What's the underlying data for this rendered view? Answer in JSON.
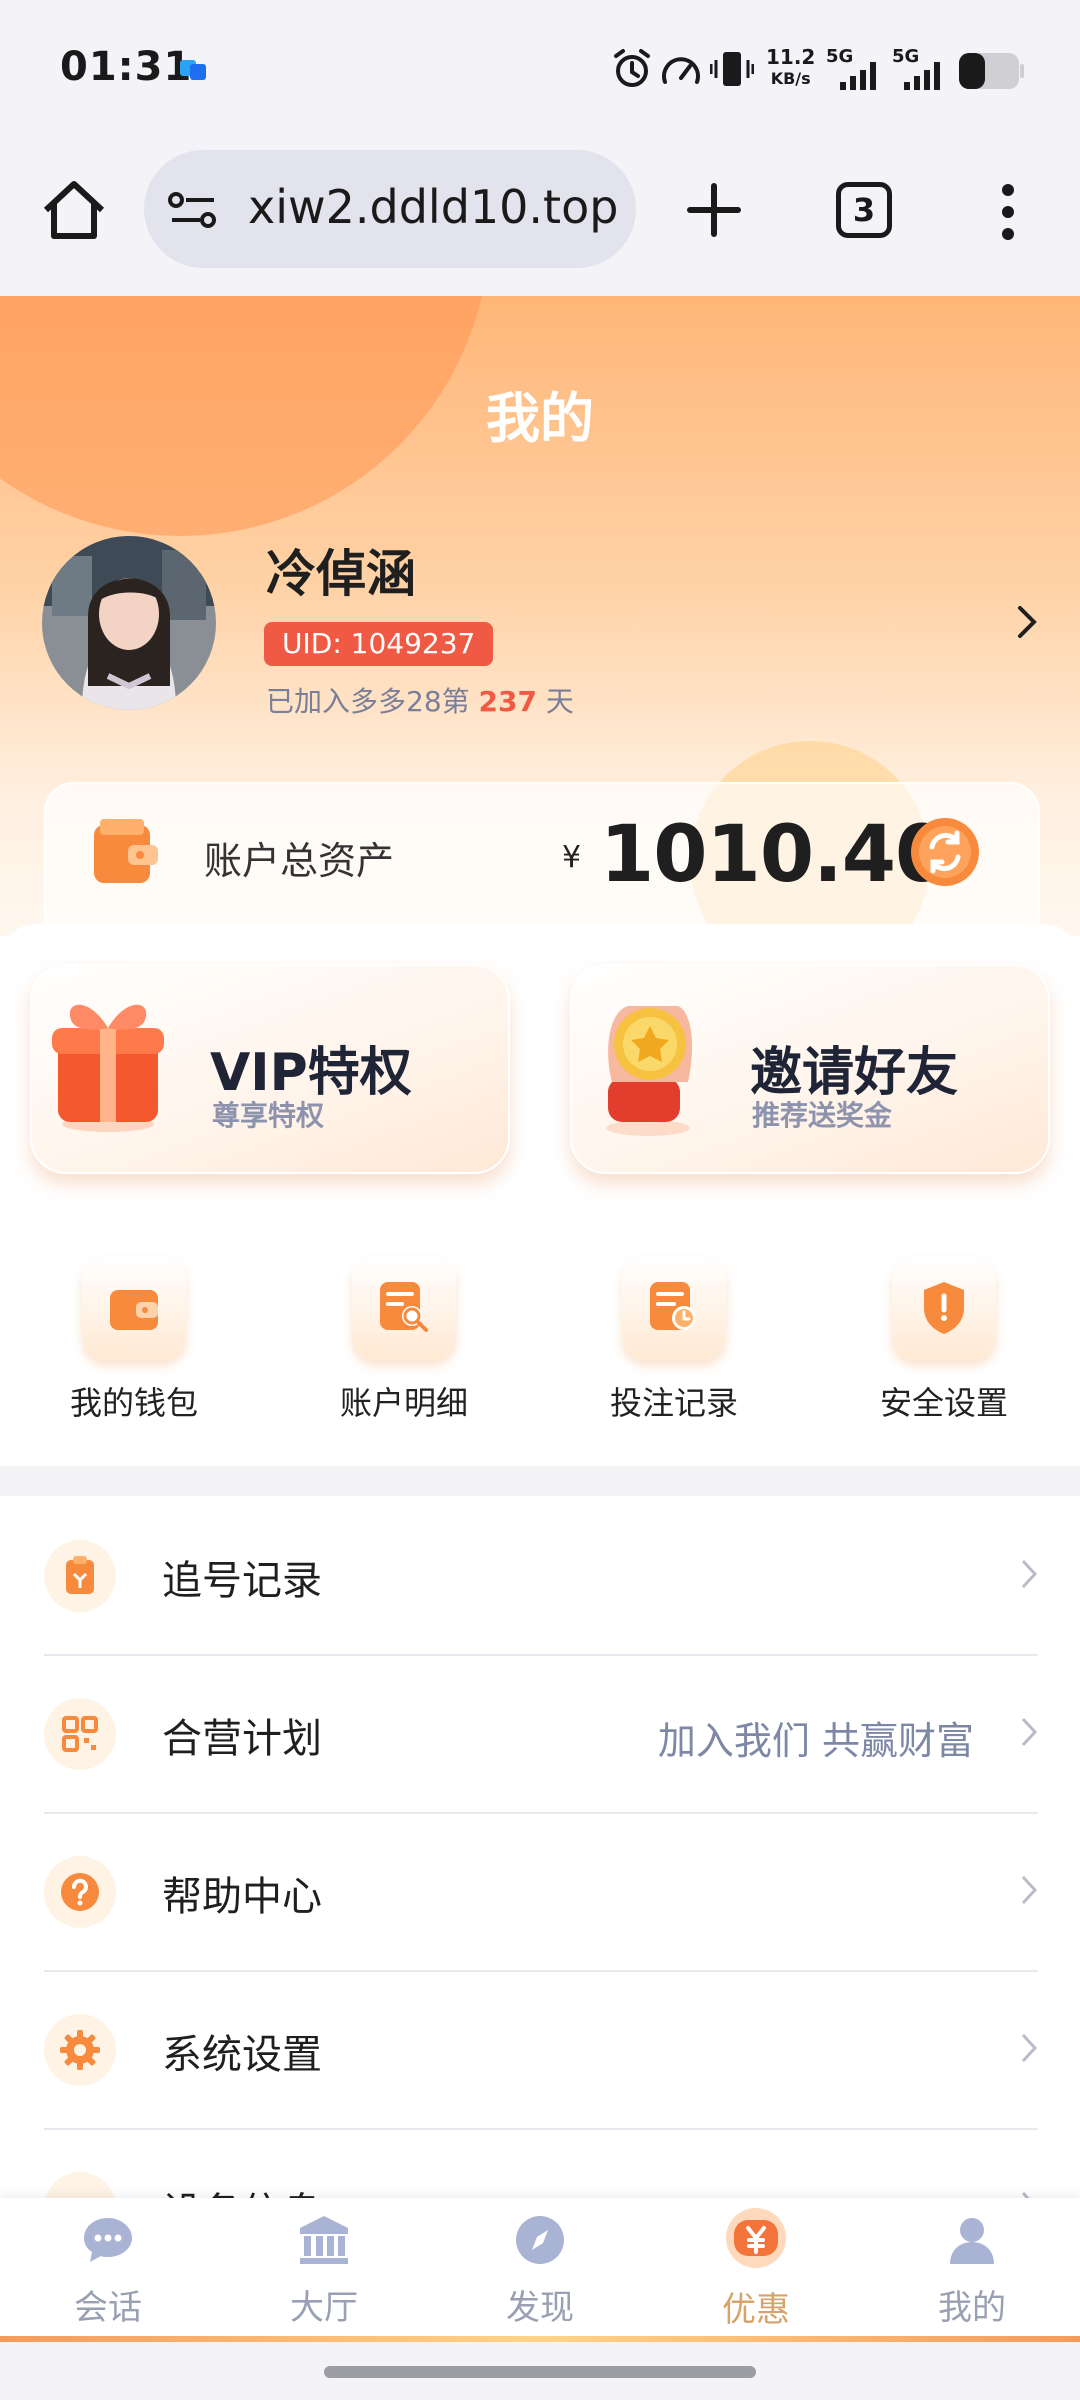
{
  "status_bar": {
    "time": "01:31",
    "net_speed_value": "11.2",
    "net_speed_unit": "KB/s",
    "sim1": "5G",
    "sim2": "5G"
  },
  "browser": {
    "url": "xiw2.ddld10.top",
    "tab_count": "3"
  },
  "header": {
    "title": "我的",
    "username": "冷倬涵",
    "uid": "UID: 1049237",
    "joined_prefix": "已加入多多28第",
    "joined_days": "237",
    "joined_suffix": "天"
  },
  "assets": {
    "label": "账户总资产",
    "currency": "¥",
    "value": "1010.40"
  },
  "promos": [
    {
      "title": "VIP特权",
      "subtitle": "尊享特权",
      "icon": "gift-box-icon"
    },
    {
      "title": "邀请好友",
      "subtitle": "推荐送奖金",
      "icon": "coin-hand-icon"
    }
  ],
  "quick_actions": [
    {
      "label": "我的钱包",
      "icon": "wallet-icon"
    },
    {
      "label": "账户明细",
      "icon": "account-search-icon"
    },
    {
      "label": "投注记录",
      "icon": "bet-record-icon"
    },
    {
      "label": "安全设置",
      "icon": "shield-icon"
    }
  ],
  "menu": [
    {
      "label": "追号记录",
      "hint": "",
      "icon": "clipboard-icon"
    },
    {
      "label": "合营计划",
      "hint": "加入我们 共赢财富",
      "icon": "qr-code-icon"
    },
    {
      "label": "帮助中心",
      "hint": "",
      "icon": "help-icon"
    },
    {
      "label": "系统设置",
      "hint": "",
      "icon": "gear-icon"
    },
    {
      "label": "设备信息",
      "hint": "",
      "icon": "device-icon"
    }
  ],
  "bottom_nav": [
    {
      "label": "会话",
      "icon": "chat-icon"
    },
    {
      "label": "大厅",
      "icon": "bank-icon"
    },
    {
      "label": "发现",
      "icon": "compass-icon"
    },
    {
      "label": "优惠",
      "icon": "discount-icon",
      "active": true
    },
    {
      "label": "我的",
      "icon": "user-icon"
    }
  ],
  "colors": {
    "accent": "#f39b5c",
    "badge_red": "#f05a45",
    "active_nav": "#d7a36a",
    "muted_text": "#7d88a6"
  }
}
